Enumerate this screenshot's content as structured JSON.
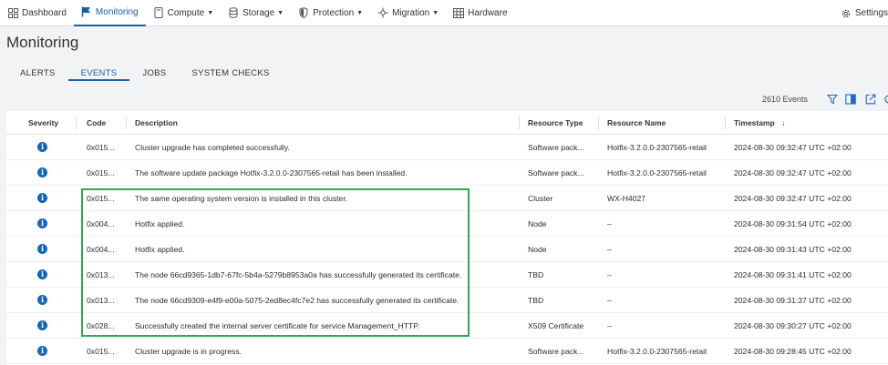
{
  "nav": {
    "items": [
      {
        "label": "Dashboard",
        "icon": "dashboard-icon"
      },
      {
        "label": "Monitoring",
        "icon": "flag-icon"
      },
      {
        "label": "Compute",
        "icon": "compute-icon"
      },
      {
        "label": "Storage",
        "icon": "storage-icon"
      },
      {
        "label": "Protection",
        "icon": "shield-icon"
      },
      {
        "label": "Migration",
        "icon": "migration-icon"
      },
      {
        "label": "Hardware",
        "icon": "hardware-icon"
      }
    ],
    "settings_label": "Settings",
    "accent": "#1a5fa8"
  },
  "page": {
    "title": "Monitoring"
  },
  "tabs": [
    "ALERTS",
    "EVENTS",
    "JOBS",
    "SYSTEM CHECKS"
  ],
  "toolbar": {
    "event_count": "2610 Events"
  },
  "table": {
    "columns": [
      "Severity",
      "Code",
      "Description",
      "Resource Type",
      "Resource Name",
      "Timestamp"
    ],
    "sort_indicator": "↓",
    "rows": [
      {
        "severity": "info",
        "code": "0x015...",
        "description": "Cluster upgrade has completed successfully.",
        "resource_type": "Software pack...",
        "resource_name": "Hotfix-3.2.0.0-2307565-retail",
        "timestamp": "2024-08-30 09:32:47 UTC +02:00"
      },
      {
        "severity": "info",
        "code": "0x015...",
        "description": "The software update package Hotfix-3.2.0.0-2307565-retail has been installed.",
        "resource_type": "Software pack...",
        "resource_name": "Hotfix-3.2.0.0-2307565-retail",
        "timestamp": "2024-08-30 09:32:47 UTC +02:00"
      },
      {
        "severity": "info",
        "code": "0x015...",
        "description": "The same operating system version is installed in this cluster.",
        "resource_type": "Cluster",
        "resource_name": "WX-H4027",
        "timestamp": "2024-08-30 09:32:47 UTC +02:00"
      },
      {
        "severity": "info",
        "code": "0x004...",
        "description": "Hotfix applied.",
        "resource_type": "Node",
        "resource_name": "–",
        "timestamp": "2024-08-30 09:31:54 UTC +02:00"
      },
      {
        "severity": "info",
        "code": "0x004...",
        "description": "Hotfix applied.",
        "resource_type": "Node",
        "resource_name": "–",
        "timestamp": "2024-08-30 09:31:43 UTC +02:00"
      },
      {
        "severity": "info",
        "code": "0x013...",
        "description": "The node 66cd9365-1db7-67fc-5b4a-5279b8953a0a has successfully generated its certificate.",
        "resource_type": "TBD",
        "resource_name": "–",
        "timestamp": "2024-08-30 09:31:41 UTC +02:00"
      },
      {
        "severity": "info",
        "code": "0x013...",
        "description": "The node 66cd9309-e4f9-e00a-5075-2ed8ec4fc7e2 has successfully generated its certificate.",
        "resource_type": "TBD",
        "resource_name": "–",
        "timestamp": "2024-08-30 09:31:37 UTC +02:00"
      },
      {
        "severity": "info",
        "code": "0x028...",
        "description": "Successfully created the internal server certificate for service Management_HTTP.",
        "resource_type": "X509 Certificate",
        "resource_name": "–",
        "timestamp": "2024-08-30 09:30:27 UTC +02:00"
      },
      {
        "severity": "info",
        "code": "0x015...",
        "description": "Cluster upgrade is in progress.",
        "resource_type": "Software pack...",
        "resource_name": "Hotfix-3.2.0.0-2307565-retail",
        "timestamp": "2024-08-30 09:28:45 UTC +02:00"
      }
    ]
  },
  "annotation": {
    "highlight_color": "#2fa84f"
  }
}
